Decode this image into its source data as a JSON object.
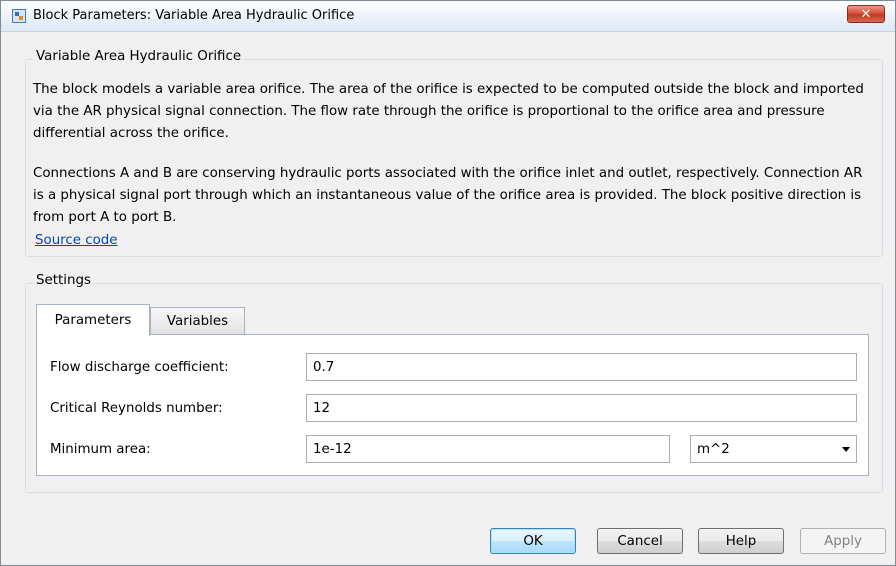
{
  "window": {
    "title": "Block Parameters: Variable Area Hydraulic Orifice",
    "close_glyph": "✕"
  },
  "description": {
    "group_title": "Variable Area Hydraulic Orifice",
    "paragraph1": "The block models a variable area orifice. The area of the orifice is expected to be computed outside the block and imported via the AR physical signal connection. The flow rate through the orifice is proportional to the orifice area and pressure differential across the orifice.",
    "paragraph2": "Connections A and B are conserving hydraulic ports associated with the orifice inlet and outlet, respectively. Connection AR is a physical signal port through which an instantaneous value of the orifice area is provided. The block positive direction is from port A to port B.",
    "source_link": "Source code"
  },
  "settings": {
    "group_title": "Settings",
    "tabs": [
      {
        "label": "Parameters",
        "active": true
      },
      {
        "label": "Variables",
        "active": false
      }
    ],
    "params": {
      "flow_discharge": {
        "label": "Flow discharge coefficient:",
        "value": "0.7"
      },
      "critical_reynolds": {
        "label": "Critical Reynolds number:",
        "value": "12"
      },
      "minimum_area": {
        "label": "Minimum area:",
        "value": "1e-12",
        "unit": "m^2"
      }
    }
  },
  "buttons": {
    "ok": "OK",
    "cancel": "Cancel",
    "help": "Help",
    "apply": "Apply"
  },
  "colors": {
    "link": "#0645ad",
    "close_button": "#c23a25"
  }
}
